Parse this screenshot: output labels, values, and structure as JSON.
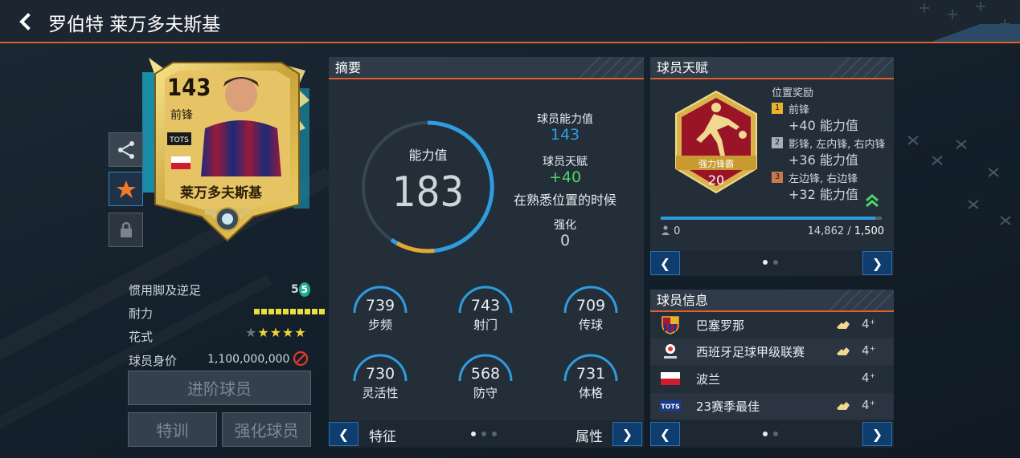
{
  "header": {
    "title": "罗伯特 莱万多夫斯基"
  },
  "card": {
    "rating": "143",
    "position": "前锋",
    "badge": "TOTS",
    "name": "莱万多夫斯基"
  },
  "player_stats": {
    "weak_foot_label": "惯用脚及逆足",
    "weak_foot_value": "5",
    "skill_foot_value": "5",
    "stamina_label": "耐力",
    "skill_moves_label": "花式",
    "skill_moves_stars": 4,
    "price_label": "球员身价",
    "price_value": "1,100,000,000"
  },
  "actions": {
    "rank_up": "进阶球员",
    "training": "特训",
    "enhance": "强化球员"
  },
  "summary": {
    "title": "摘要",
    "ovr_label": "能力值",
    "ovr_value": "183",
    "base_label": "球员能力值",
    "base_value": "143",
    "talent_label": "球员天赋",
    "talent_value": "+40",
    "talent_note": "在熟悉位置的时候",
    "enhance_label": "强化",
    "enhance_value": "0",
    "attributes": [
      {
        "value": "739",
        "name": "步频"
      },
      {
        "value": "743",
        "name": "射门"
      },
      {
        "value": "709",
        "name": "传球"
      },
      {
        "value": "730",
        "name": "灵活性"
      },
      {
        "value": "568",
        "name": "防守"
      },
      {
        "value": "731",
        "name": "体格"
      }
    ],
    "footer_left": "特征",
    "footer_right": "属性"
  },
  "talent": {
    "title": "球员天赋",
    "badge_name": "强力锋霸",
    "badge_level": "20",
    "bonus_title": "位置奖励",
    "bonuses": [
      {
        "num": "1",
        "positions": "前锋",
        "value": "+40 能力值",
        "color": "#e8b22a"
      },
      {
        "num": "2",
        "positions": "影锋, 左内锋, 右内锋",
        "value": "+36 能力值",
        "color": "#a8b0ba"
      },
      {
        "num": "3",
        "positions": "左边锋, 右边锋",
        "value": "+32 能力值",
        "color": "#c87a4a"
      }
    ],
    "progress_current": "14,862",
    "progress_max": "1,500",
    "progress_fraction": 0.97,
    "progress_left_value": "0"
  },
  "info": {
    "title": "球员信息",
    "rows": [
      {
        "name": "巴塞罗那",
        "level": "4",
        "icon": "club-crest-icon"
      },
      {
        "name": "西班牙足球甲级联赛",
        "level": "4",
        "icon": "league-logo-icon"
      },
      {
        "name": "波兰",
        "level": "4",
        "icon": "nation-flag-icon"
      },
      {
        "name": "23赛季最佳",
        "level": "4",
        "icon": "program-logo-icon"
      }
    ]
  },
  "colors": {
    "accent": "#e0602a",
    "blue": "#2e9de0",
    "gold": "#e8b22a",
    "green": "#4ad66a"
  }
}
